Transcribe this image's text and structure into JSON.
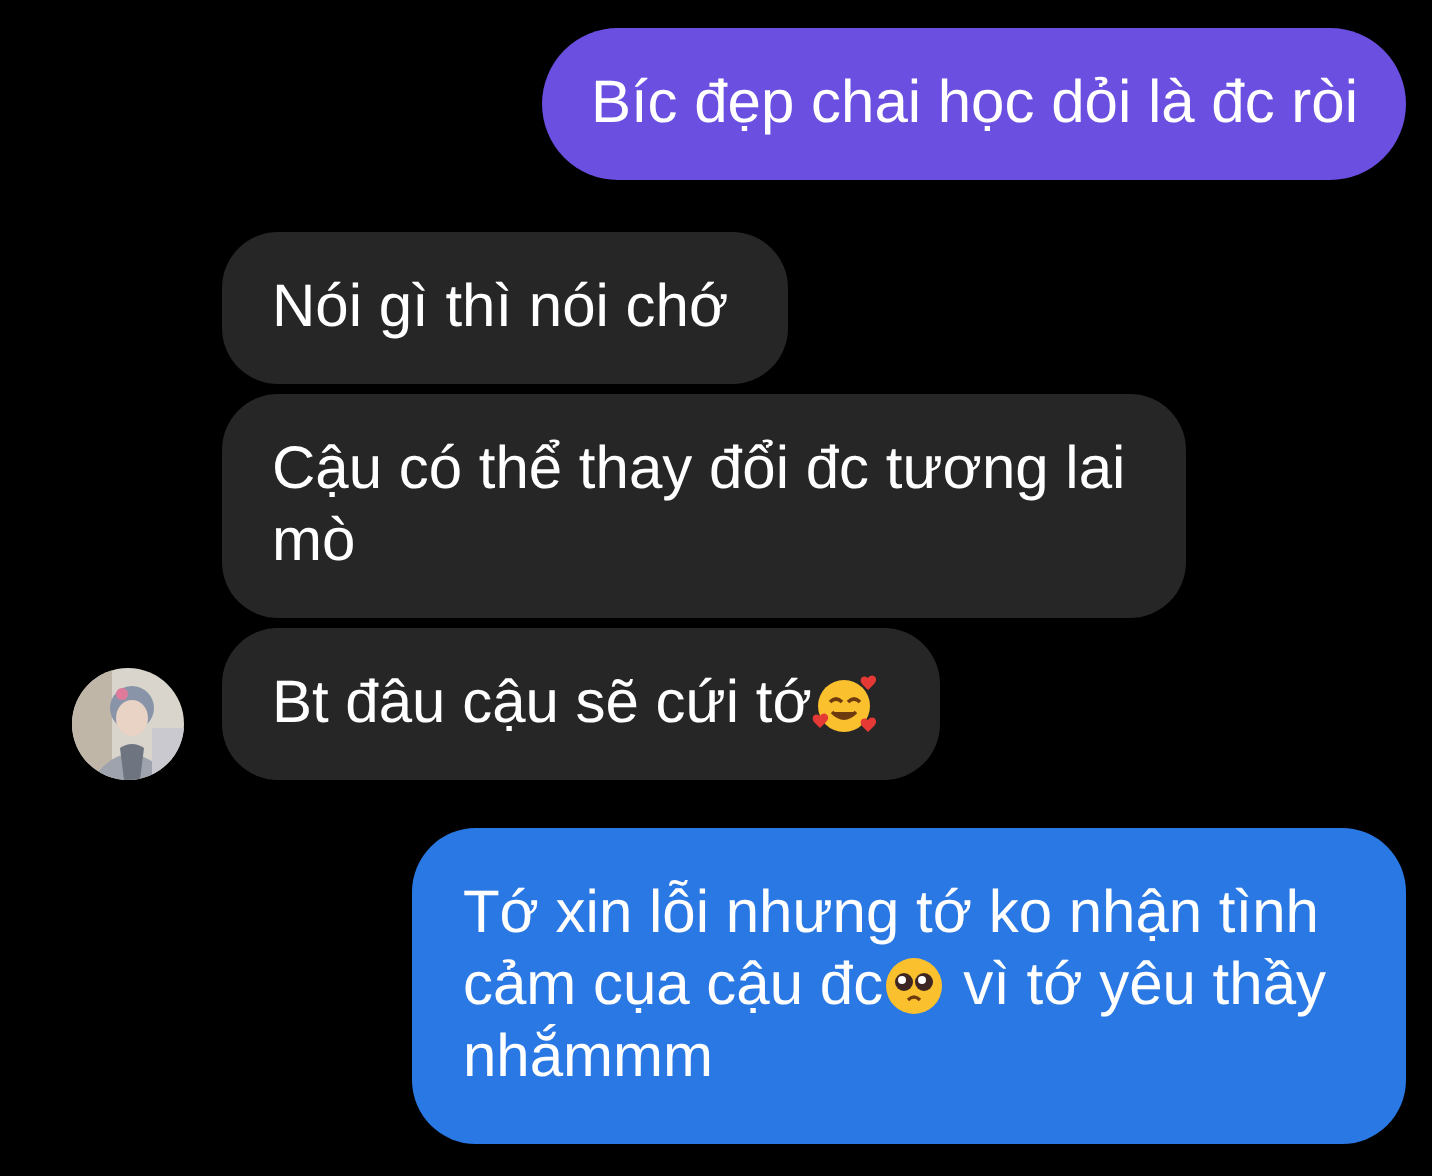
{
  "messages": [
    {
      "kind": "sent",
      "lines": [
        [
          {
            "kind": "text",
            "text": "Bíc đẹp chai học dỏi là đc ròi"
          }
        ]
      ]
    },
    {
      "kind": "received",
      "avatar": false,
      "lines": [
        [
          {
            "kind": "text",
            "text": "Nói gì thì nói chớ"
          }
        ]
      ]
    },
    {
      "kind": "received",
      "avatar": false,
      "lines": [
        [
          {
            "kind": "text",
            "text": "Cậu có thể thay đổi đc tương lai"
          }
        ],
        [
          {
            "kind": "text",
            "text": "mò"
          }
        ]
      ]
    },
    {
      "kind": "received",
      "avatar": true,
      "lines": [
        [
          {
            "kind": "text",
            "text": "Bt đâu cậu sẽ cứi tớ"
          },
          {
            "kind": "hearts"
          }
        ]
      ]
    },
    {
      "kind": "sent",
      "lines": [
        [
          {
            "kind": "text",
            "text": "Tớ xin lỗi nhưng tớ ko nhận tình"
          }
        ],
        [
          {
            "kind": "text",
            "text": "cảm cụa cậu đc"
          },
          {
            "kind": "pleading"
          },
          {
            "kind": "text",
            "text": "vì tớ yêu thầy"
          }
        ],
        [
          {
            "kind": "text",
            "text": "nhắmmm"
          }
        ]
      ]
    }
  ]
}
